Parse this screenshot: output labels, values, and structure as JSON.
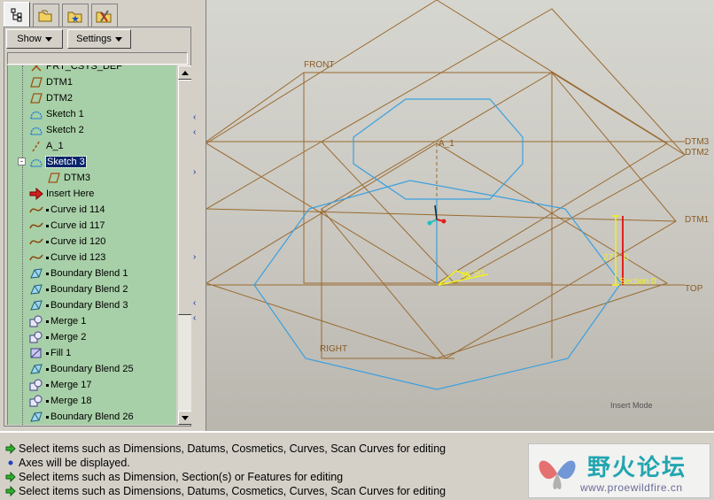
{
  "tabs": [
    {
      "name": "model-tree-tab",
      "icon": "model-tree-icon"
    },
    {
      "name": "folder-browser-tab",
      "icon": "folder-icon"
    },
    {
      "name": "favorites-tab",
      "icon": "favorites-icon"
    },
    {
      "name": "connections-tab",
      "icon": "tools-icon"
    }
  ],
  "menus": {
    "show_label": "Show",
    "settings_label": "Settings"
  },
  "tree": {
    "items": [
      {
        "label": "PRT_CSYS_DEF",
        "icon": "csys-icon",
        "indent": 0,
        "marker": false,
        "selected": false
      },
      {
        "label": "DTM1",
        "icon": "datum-plane-icon",
        "indent": 0,
        "marker": false,
        "selected": false
      },
      {
        "label": "DTM2",
        "icon": "datum-plane-icon",
        "indent": 0,
        "marker": false,
        "selected": false
      },
      {
        "label": "Sketch 1",
        "icon": "sketch-icon",
        "indent": 0,
        "marker": false,
        "selected": false
      },
      {
        "label": "Sketch 2",
        "icon": "sketch-icon",
        "indent": 0,
        "marker": false,
        "selected": false
      },
      {
        "label": "A_1",
        "icon": "axis-icon",
        "indent": 0,
        "marker": false,
        "selected": false
      },
      {
        "label": "Sketch 3",
        "icon": "sketch-icon",
        "indent": 0,
        "marker": false,
        "selected": true
      },
      {
        "label": "DTM3",
        "icon": "datum-plane-icon",
        "indent": 1,
        "marker": false,
        "selected": false
      },
      {
        "label": "Insert Here",
        "icon": "insert-arrow-icon",
        "indent": 0,
        "marker": false,
        "selected": false
      },
      {
        "label": "Curve id 114",
        "icon": "curve-icon",
        "indent": 0,
        "marker": true,
        "selected": false
      },
      {
        "label": "Curve id 117",
        "icon": "curve-icon",
        "indent": 0,
        "marker": true,
        "selected": false
      },
      {
        "label": "Curve id 120",
        "icon": "curve-icon",
        "indent": 0,
        "marker": true,
        "selected": false
      },
      {
        "label": "Curve id 123",
        "icon": "curve-icon",
        "indent": 0,
        "marker": true,
        "selected": false
      },
      {
        "label": "Boundary Blend 1",
        "icon": "boundary-blend-icon",
        "indent": 0,
        "marker": true,
        "selected": false
      },
      {
        "label": "Boundary Blend 2",
        "icon": "boundary-blend-icon",
        "indent": 0,
        "marker": true,
        "selected": false
      },
      {
        "label": "Boundary Blend 3",
        "icon": "boundary-blend-icon",
        "indent": 0,
        "marker": true,
        "selected": false
      },
      {
        "label": "Merge 1",
        "icon": "merge-icon",
        "indent": 0,
        "marker": true,
        "selected": false
      },
      {
        "label": "Merge 2",
        "icon": "merge-icon",
        "indent": 0,
        "marker": true,
        "selected": false
      },
      {
        "label": "Fill 1",
        "icon": "fill-icon",
        "indent": 0,
        "marker": true,
        "selected": false
      },
      {
        "label": "Boundary Blend 25",
        "icon": "boundary-blend-icon",
        "indent": 0,
        "marker": true,
        "selected": false
      },
      {
        "label": "Merge 17",
        "icon": "merge-icon",
        "indent": 0,
        "marker": true,
        "selected": false
      },
      {
        "label": "Merge 18",
        "icon": "merge-icon",
        "indent": 0,
        "marker": true,
        "selected": false
      },
      {
        "label": "Boundary Blend 26",
        "icon": "boundary-blend-icon",
        "indent": 0,
        "marker": true,
        "selected": false
      }
    ]
  },
  "graphics": {
    "datum_labels": {
      "front": "FRONT",
      "right": "RIGHT",
      "top": "TOP",
      "dtm1": "DTM1",
      "dtm2": "DTM2",
      "dtm3": "DTM3",
      "axis": "A_1",
      "section": "Section 0",
      "dim_45": "45",
      "dim_90": "90",
      "dim_27": "27",
      "dim_0": "0"
    },
    "mode": "Insert Mode",
    "colors": {
      "datum": "#9a6a30",
      "curve": "#3aa0e0",
      "dimension": "#f0f020",
      "marker_red": "#e02020"
    }
  },
  "messages": [
    {
      "icon": "green-arrow-icon",
      "text": "Select items such as Dimensions, Datums, Cosmetics, Curves, Scan Curves for editing"
    },
    {
      "icon": "info-bullet-icon",
      "text": "Axes will be displayed."
    },
    {
      "icon": "green-arrow-icon",
      "text": "Select items such as Dimension, Section(s) or Features for editing"
    },
    {
      "icon": "green-arrow-icon",
      "text": "Select items such as Dimensions, Datums, Cosmetics, Curves, Scan Curves for editing"
    }
  ],
  "watermark": {
    "title": "野火论坛",
    "url": "www.proewildfire.cn"
  }
}
